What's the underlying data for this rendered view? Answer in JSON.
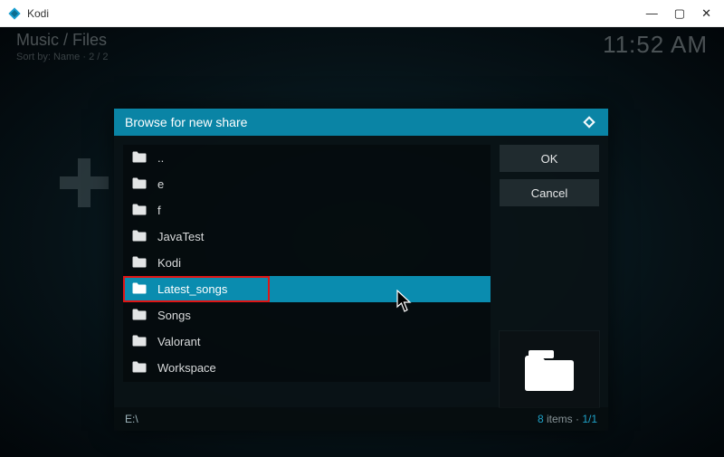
{
  "window": {
    "title": "Kodi"
  },
  "header": {
    "breadcrumb": "Music / Files",
    "sortline": "Sort by: Name  ·  2 / 2",
    "clock": "11:52 AM"
  },
  "dialog": {
    "title": "Browse for new share",
    "ok": "OK",
    "cancel": "Cancel",
    "path": "E:\\",
    "count_num": "8",
    "count_label": " items · ",
    "count_page": "1/1"
  },
  "items": [
    {
      "label": "..",
      "selected": false
    },
    {
      "label": "e",
      "selected": false
    },
    {
      "label": "f",
      "selected": false
    },
    {
      "label": "JavaTest",
      "selected": false
    },
    {
      "label": "Kodi",
      "selected": false
    },
    {
      "label": "Latest_songs",
      "selected": true,
      "highlight": true
    },
    {
      "label": "Songs",
      "selected": false
    },
    {
      "label": "Valorant",
      "selected": false
    },
    {
      "label": "Workspace",
      "selected": false
    }
  ]
}
